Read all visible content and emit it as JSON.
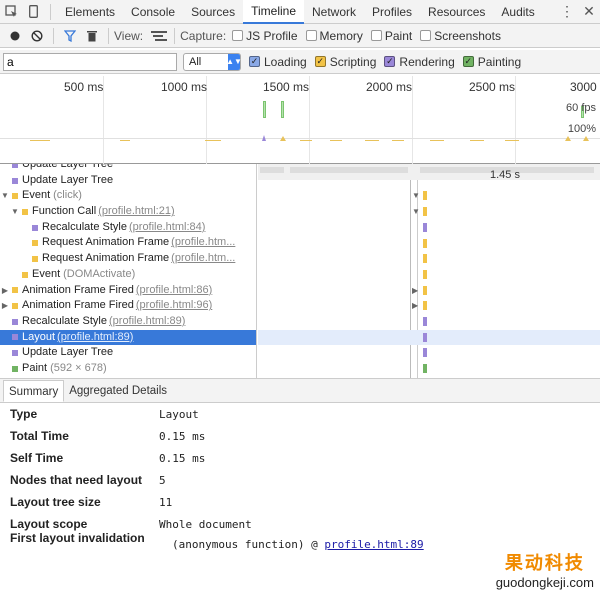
{
  "tabbar": {
    "tabs": [
      "Elements",
      "Console",
      "Sources",
      "Timeline",
      "Network",
      "Profiles",
      "Resources",
      "Audits"
    ],
    "active": "Timeline"
  },
  "toolbar": {
    "view_label": "View:",
    "capture_label": "Capture:",
    "capture_options": [
      "JS Profile",
      "Memory",
      "Paint",
      "Screenshots"
    ]
  },
  "filter": {
    "value": "a",
    "select_value": "All",
    "categories": [
      {
        "label": "Loading",
        "color": "#8aa9e7"
      },
      {
        "label": "Scripting",
        "color": "#f2c346"
      },
      {
        "label": "Rendering",
        "color": "#9a87d8"
      },
      {
        "label": "Painting",
        "color": "#71b363"
      }
    ]
  },
  "overview": {
    "ticks": [
      "500 ms",
      "1000 ms",
      "1500 ms",
      "2000 ms",
      "2500 ms",
      "3000"
    ],
    "fps_label": "60 fps",
    "cpu_label": "100%"
  },
  "tree": {
    "rows": [
      {
        "label": "Update Layer Tree",
        "link": "",
        "paren": "",
        "color": "#9a87d8",
        "twisty": "",
        "indent": 0
      },
      {
        "label": "Update Layer Tree",
        "link": "",
        "paren": "",
        "color": "#9a87d8",
        "twisty": "",
        "indent": 0
      },
      {
        "label": "Event",
        "link": "",
        "paren": "(click)",
        "color": "#f2c346",
        "twisty": "▼",
        "indent": 0
      },
      {
        "label": "Function Call",
        "link": "(profile.html:21)",
        "paren": "",
        "color": "#f2c346",
        "twisty": "▼",
        "indent": 1
      },
      {
        "label": "Recalculate Style",
        "link": "(profile.html:84)",
        "paren": "",
        "color": "#9a87d8",
        "twisty": "",
        "indent": 2
      },
      {
        "label": "Request Animation Frame",
        "link": "(profile.htm...",
        "paren": "",
        "color": "#f2c346",
        "twisty": "",
        "indent": 2
      },
      {
        "label": "Request Animation Frame",
        "link": "(profile.htm...",
        "paren": "",
        "color": "#f2c346",
        "twisty": "",
        "indent": 2
      },
      {
        "label": "Event",
        "link": "",
        "paren": "(DOMActivate)",
        "color": "#f2c346",
        "twisty": "",
        "indent": 1
      },
      {
        "label": "Animation Frame Fired",
        "link": "(profile.html:86)",
        "paren": "",
        "color": "#f2c346",
        "twisty": "▶",
        "indent": 0
      },
      {
        "label": "Animation Frame Fired",
        "link": "(profile.html:96)",
        "paren": "",
        "color": "#f2c346",
        "twisty": "▶",
        "indent": 0
      },
      {
        "label": "Recalculate Style",
        "link": "(profile.html:89)",
        "paren": "",
        "color": "#9a87d8",
        "twisty": "",
        "indent": 0
      },
      {
        "label": "Layout",
        "link": "(profile.html:89)",
        "paren": "",
        "color": "#9a87d8",
        "twisty": "",
        "indent": 0,
        "selected": true
      },
      {
        "label": "Update Layer Tree",
        "link": "",
        "paren": "",
        "color": "#9a87d8",
        "twisty": "",
        "indent": 0
      },
      {
        "label": "Paint",
        "link": "",
        "paren": "(592 × 678)",
        "color": "#71b363",
        "twisty": "",
        "indent": 0
      }
    ]
  },
  "flame": {
    "duration": "1.45 s"
  },
  "details": {
    "tabs": [
      "Summary",
      "Aggregated Details"
    ],
    "rows": [
      {
        "key": "Type",
        "value": "Layout"
      },
      {
        "key": "Total Time",
        "value": "0.15 ms"
      },
      {
        "key": "Self Time",
        "value": "0.15 ms"
      },
      {
        "key": "Nodes that need layout",
        "value": "5"
      },
      {
        "key": "Layout tree size",
        "value": "11"
      },
      {
        "key": "Layout scope",
        "value": "Whole document"
      }
    ],
    "first_invalidation_key": "First layout invalidation",
    "first_invalidation_fn": "(anonymous function) @",
    "first_invalidation_link": "profile.html:89"
  },
  "watermark": {
    "cn": "果动科技",
    "en": "guodongkeji.com"
  }
}
